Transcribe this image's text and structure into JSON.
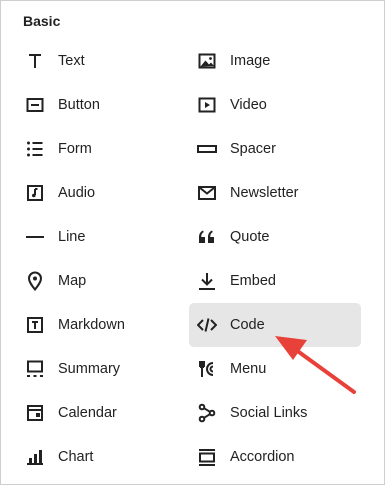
{
  "section": {
    "title": "Basic"
  },
  "left_column": [
    {
      "label": "Text",
      "icon": "text-icon"
    },
    {
      "label": "Button",
      "icon": "button-icon"
    },
    {
      "label": "Form",
      "icon": "form-icon"
    },
    {
      "label": "Audio",
      "icon": "audio-icon"
    },
    {
      "label": "Line",
      "icon": "line-icon"
    },
    {
      "label": "Map",
      "icon": "map-pin-icon"
    },
    {
      "label": "Markdown",
      "icon": "markdown-icon"
    },
    {
      "label": "Summary",
      "icon": "summary-icon"
    },
    {
      "label": "Calendar",
      "icon": "calendar-icon"
    },
    {
      "label": "Chart",
      "icon": "chart-icon"
    }
  ],
  "right_column": [
    {
      "label": "Image",
      "icon": "image-icon"
    },
    {
      "label": "Video",
      "icon": "video-icon"
    },
    {
      "label": "Spacer",
      "icon": "spacer-icon"
    },
    {
      "label": "Newsletter",
      "icon": "envelope-icon"
    },
    {
      "label": "Quote",
      "icon": "quote-icon"
    },
    {
      "label": "Embed",
      "icon": "embed-icon"
    },
    {
      "label": "Code",
      "icon": "code-icon",
      "highlighted": true
    },
    {
      "label": "Menu",
      "icon": "menu-icon"
    },
    {
      "label": "Social Links",
      "icon": "social-links-icon"
    },
    {
      "label": "Accordion",
      "icon": "accordion-icon"
    }
  ],
  "colors": {
    "highlight_bg": "#e6e6e6",
    "annotation_arrow": "#e8413a",
    "text": "#222222"
  }
}
